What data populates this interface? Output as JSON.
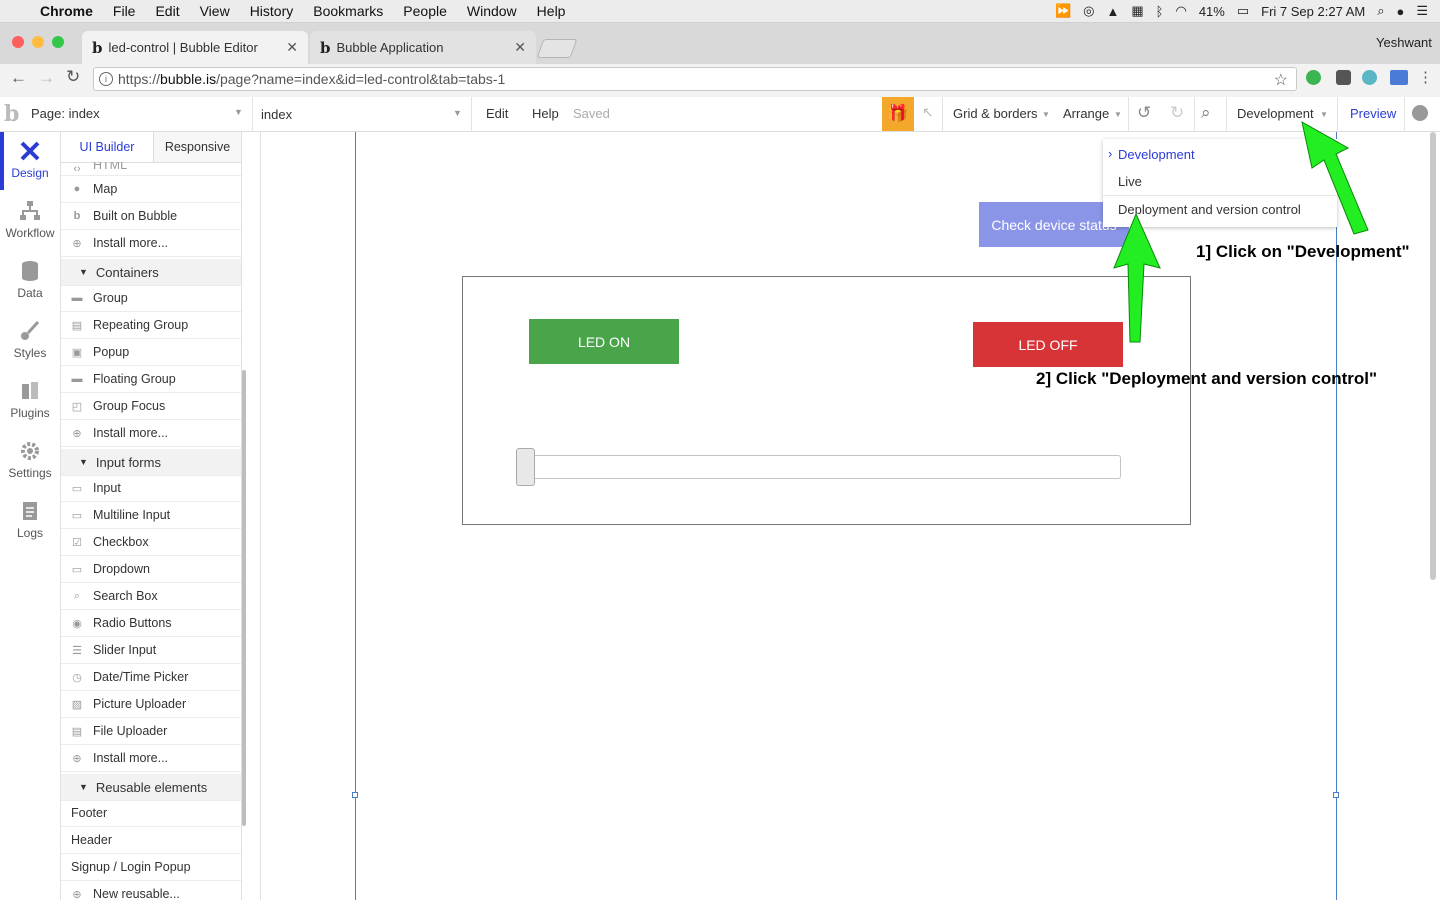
{
  "menubar": {
    "app": "Chrome",
    "items": [
      "File",
      "Edit",
      "View",
      "History",
      "Bookmarks",
      "People",
      "Window",
      "Help"
    ],
    "battery": "41%",
    "datetime": "Fri 7 Sep  2:27 AM"
  },
  "browser": {
    "tabs": [
      {
        "title": "led-control | Bubble Editor"
      },
      {
        "title": "Bubble Application"
      }
    ],
    "user": "Yeshwant",
    "url_prefix": "https://",
    "url_host": "bubble.is",
    "url_path": "/page?name=index&id=led-control&tab=tabs-1"
  },
  "toolbar": {
    "page_select": "Page: index",
    "element_select": "index",
    "edit": "Edit",
    "help": "Help",
    "saved": "Saved",
    "grid": "Grid & borders",
    "arrange": "Arrange",
    "version": "Development",
    "preview": "Preview"
  },
  "rail": [
    {
      "label": "Design"
    },
    {
      "label": "Workflow"
    },
    {
      "label": "Data"
    },
    {
      "label": "Styles"
    },
    {
      "label": "Plugins"
    },
    {
      "label": "Settings"
    },
    {
      "label": "Logs"
    }
  ],
  "panel": {
    "tabs": [
      "UI Builder",
      "Responsive"
    ],
    "cut_item": "HTML",
    "visual_items": [
      "Map",
      "Built on Bubble",
      "Install more..."
    ],
    "containers": {
      "title": "Containers",
      "items": [
        "Group",
        "Repeating Group",
        "Popup",
        "Floating Group",
        "Group Focus",
        "Install more..."
      ]
    },
    "inputs": {
      "title": "Input forms",
      "items": [
        "Input",
        "Multiline Input",
        "Checkbox",
        "Dropdown",
        "Search Box",
        "Radio Buttons",
        "Slider Input",
        "Date/Time Picker",
        "Picture Uploader",
        "File Uploader",
        "Install more..."
      ]
    },
    "reusable": {
      "title": "Reusable elements",
      "items": [
        "Footer",
        "Header",
        "Signup / Login Popup",
        "New reusable..."
      ]
    }
  },
  "canvas": {
    "check_status": "Check device status",
    "led_on": "LED ON",
    "led_off": "LED OFF",
    "slider_value": 0
  },
  "dropdown": {
    "items": [
      "Development",
      "Live",
      "Deployment and version control"
    ],
    "selected_marker": "›"
  },
  "annotations": {
    "step1": "1] Click on \"Development\"",
    "step2": "2] Click \"Deployment and version control\""
  },
  "colors": {
    "led_on": "#4aa54a",
    "led_off": "#d63437",
    "check_status": "#8b95e8",
    "accent": "#2b3cd6",
    "gift": "#f4a82b",
    "arrow": "#22ee22"
  }
}
